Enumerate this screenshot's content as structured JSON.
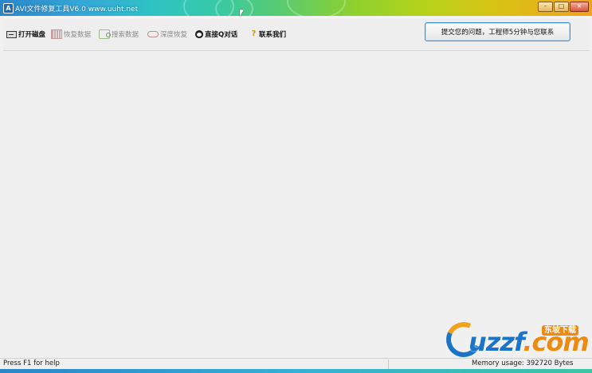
{
  "window": {
    "title": "AVI文件修复工具V6.0 www.uuht.net",
    "app_icon": "A",
    "controls": {
      "minimize": "-",
      "maximize": "□",
      "close": "×"
    }
  },
  "toolbar": {
    "items": [
      {
        "label": "打开磁盘",
        "icon": "disk-icon",
        "state": "active"
      },
      {
        "label": "恢复数据",
        "icon": "data-icon",
        "state": "disabled"
      },
      {
        "label": "搜索数据",
        "icon": "search-data-icon",
        "state": "disabled"
      },
      {
        "label": "深度恢复",
        "icon": "deep-recover-icon",
        "state": "disabled"
      },
      {
        "label": "直接Q对话",
        "icon": "qq-icon",
        "state": "active"
      },
      {
        "label": "联系我们",
        "icon": "help-icon",
        "state": "active"
      }
    ],
    "submit_button": "提交您的问题，工程师5分钟与您联系"
  },
  "watermark": {
    "text_main": "uzzf",
    "text_suffix": ".com",
    "badge": "东坡下载"
  },
  "statusbar": {
    "help_text": "Press F1 for help",
    "memory_text": "Memory usage: 392720 Bytes"
  },
  "colors": {
    "accent_blue": "#1b74c8",
    "accent_orange": "#ec8a12",
    "button_border": "#3b8fd0"
  }
}
